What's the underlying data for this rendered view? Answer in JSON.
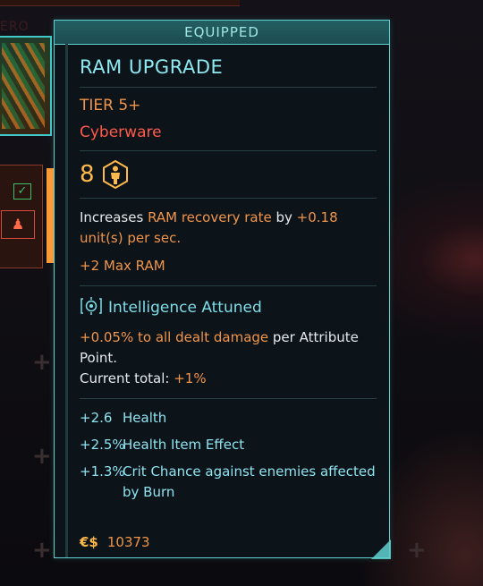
{
  "background": {
    "ghost_label": "ERO"
  },
  "tooltip": {
    "status_label": "EQUIPPED",
    "item_name": "RAM UPGRADE",
    "tier": "TIER 5+",
    "category": "Cyberware",
    "capacity_cost": "8",
    "description": {
      "prefix": "Increases ",
      "highlight": "RAM recovery rate",
      "middle": " by ",
      "value": "+0.18 unit(s) per sec."
    },
    "max_ram": "+2 Max RAM",
    "attunement": {
      "label": "Intelligence Attuned",
      "bonus": "+0.05% to all dealt damage",
      "bonus_suffix": " per Attribute Point.",
      "current_label": "Current total: ",
      "current_value": "+1%"
    },
    "stats": [
      {
        "value": "+2.6",
        "label": "Health"
      },
      {
        "value": "+2.5%",
        "label": "Health Item Effect"
      },
      {
        "value": "+1.3%",
        "label": "Crit Chance against enemies affected by Burn"
      }
    ],
    "currency_symbol": "€$",
    "price": "10373"
  },
  "colors": {
    "accent_cyan": "#5fd1d1",
    "highlight_orange": "#f0954a",
    "category_red": "#ff5a4a",
    "cost_yellow": "#ffb84a"
  },
  "icons": [
    "cyberware-capacity-icon",
    "attunement-icon",
    "eurodollar-icon",
    "check-icon"
  ]
}
